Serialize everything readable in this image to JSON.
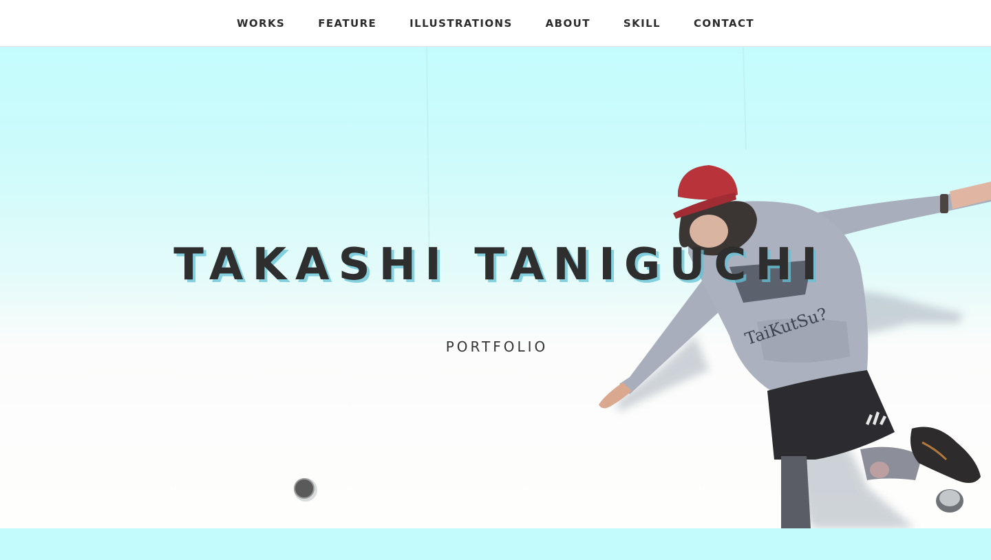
{
  "nav": {
    "items": [
      {
        "label": "WORKS"
      },
      {
        "label": "FEATURE"
      },
      {
        "label": "ILLUSTRATIONS"
      },
      {
        "label": "ABOUT"
      },
      {
        "label": "SKILL"
      },
      {
        "label": "CONTACT"
      }
    ]
  },
  "hero": {
    "title": "TAKASHI TANIGUCHI",
    "subtitle": "PORTFOLIO",
    "photo": {
      "icon": "person-jumping-photo",
      "hoodie_text": "TaiKutSu?",
      "cap_color": "#b8333a",
      "hoodie_color": "#a9afbd",
      "shorts_color": "#2a2a2e"
    }
  },
  "colors": {
    "accent": "#c3fbfc",
    "text": "#2b2b2b",
    "title_shadow": "#63c2d6"
  }
}
